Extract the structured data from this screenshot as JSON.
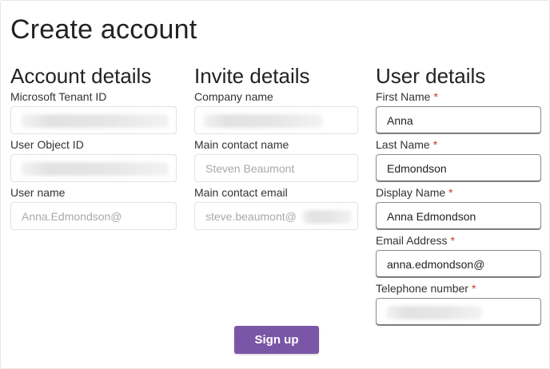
{
  "page": {
    "title": "Create account"
  },
  "account": {
    "heading": "Account details",
    "tenant_id_label": "Microsoft Tenant ID",
    "tenant_id_value": "",
    "object_id_label": "User Object ID",
    "object_id_value": "",
    "username_label": "User name",
    "username_value": "Anna.Edmondson@"
  },
  "invite": {
    "heading": "Invite details",
    "company_label": "Company name",
    "company_value": "",
    "contact_name_label": "Main contact name",
    "contact_name_value": "Steven Beaumont",
    "contact_email_label": "Main contact email",
    "contact_email_value": "steve.beaumont@"
  },
  "user": {
    "heading": "User details",
    "required_marker": "*",
    "first_name_label": "First Name",
    "first_name_value": "Anna",
    "last_name_label": "Last Name",
    "last_name_value": "Edmondson",
    "display_name_label": "Display Name",
    "display_name_value": "Anna Edmondson",
    "email_label": "Email Address",
    "email_value": "anna.edmondson@",
    "phone_label": "Telephone number",
    "phone_value": ""
  },
  "actions": {
    "signup_label": "Sign up"
  },
  "colors": {
    "primary": "#7b56a6",
    "required": "#c0392b"
  }
}
